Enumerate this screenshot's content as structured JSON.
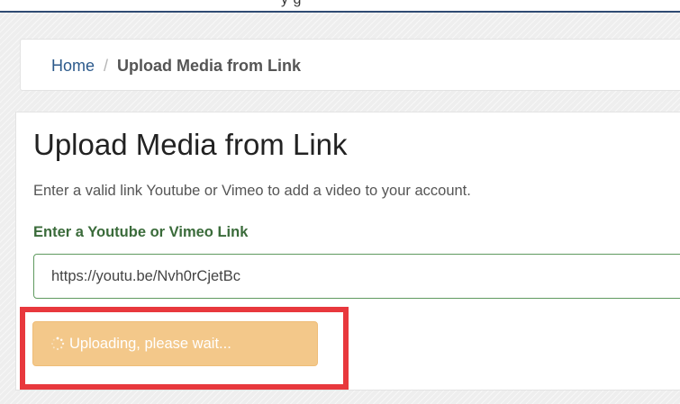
{
  "breadcrumb": {
    "home": "Home",
    "separator": "/",
    "current": "Upload Media from Link"
  },
  "page": {
    "title": "Upload Media from Link",
    "description": "Enter a valid link Youtube or Vimeo to add a video to your account.",
    "field_label": "Enter a Youtube or Vimeo Link",
    "link_value": "https://youtu.be/Nvh0rCjetBc",
    "button_label": "Uploading, please wait..."
  },
  "icons": {
    "button_icon": "spinner-icon"
  },
  "colors": {
    "title_bar_accent": "#2f4b73",
    "link": "#2c5a8c",
    "field_label": "#3a6b3a",
    "input_border": "#5f9a5f",
    "button_bg": "#f3c88a",
    "highlight": "#e8383d"
  }
}
